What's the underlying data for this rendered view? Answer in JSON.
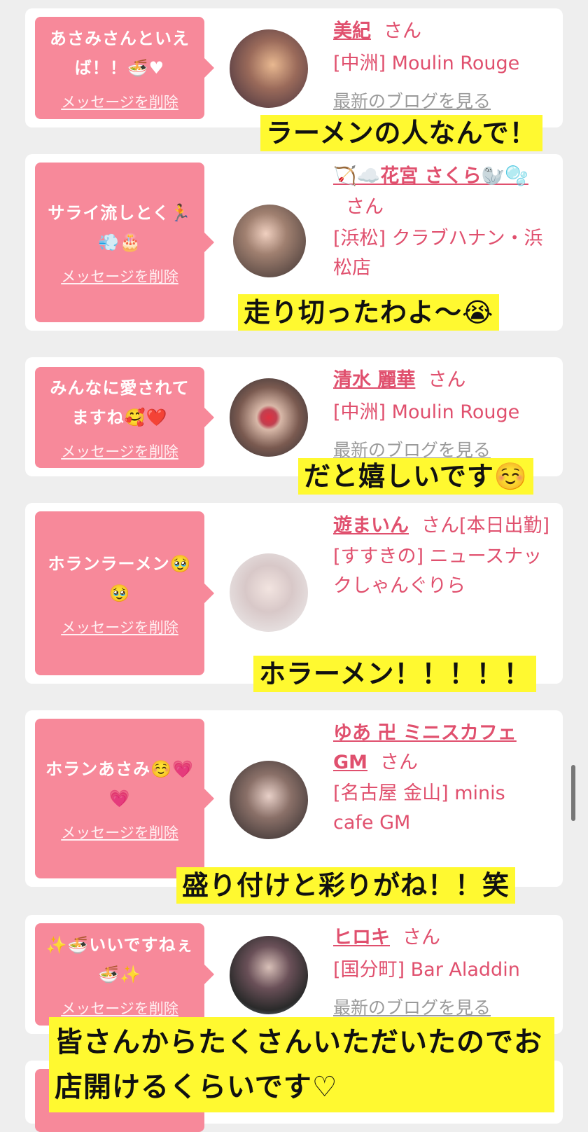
{
  "messages": [
    {
      "text": "あさみさんといえば！！🍜♥",
      "delete": "メッセージを削除",
      "name": "美紀",
      "suffix": "さん",
      "store": "[中洲] Moulin Rouge",
      "blog": "最新のブログを見る",
      "caption": "ラーメンの人なんで！"
    },
    {
      "text": "サライ流しとく🏃💨🎂",
      "delete": "メッセージを削除",
      "name": "🏹☁️花宮 さくら🦭🫧",
      "suffix": "さん",
      "store": "[浜松] クラブハナン・浜松店",
      "caption": "走り切ったわよ〜😭"
    },
    {
      "text": "みんなに愛されてますね🥰❤️",
      "delete": "メッセージを削除",
      "name": "清水 麗華",
      "suffix": "さん",
      "store": "[中洲] Moulin Rouge",
      "blog": "最新のブログを見る",
      "caption": "だと嬉しいです☺️"
    },
    {
      "text": "ホランラーメン🥹🥹",
      "delete": "メッセージを削除",
      "name": "遊まいん",
      "suffix": "さん[本日出勤]",
      "store": "[すすきの] ニュースナックしゃんぐりら",
      "caption": "ホラーメン！！！！！"
    },
    {
      "text": "ホランあさみ☺️💗💗",
      "delete": "メッセージを削除",
      "name": "ゆあ 卍 ミニスカフェGM",
      "suffix": "さん",
      "store": "[名古屋 金山] minis cafe GM",
      "caption": "盛り付けと彩りがね！！笑"
    },
    {
      "text": "✨🍜いいですねぇ🍜✨",
      "delete": "メッセージを削除",
      "name": "ヒロキ",
      "suffix": "さん",
      "store": "[国分町] Bar Aladdin",
      "blog": "最新のブログを見る",
      "caption": "皆さんからたくさんいただいたのでお店開けるくらいです♡"
    }
  ],
  "colors": {
    "bubble": "#f7899a",
    "name": "#e0506e",
    "caption_bg": "#fff930",
    "page_bg": "#eeeeee"
  }
}
